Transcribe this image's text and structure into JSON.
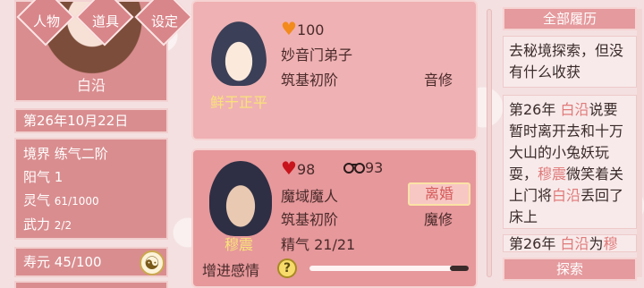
{
  "player": {
    "name": "白沿",
    "date": "第26年10月22日",
    "realm_label": "境界",
    "realm_value": "练气二阶",
    "yang_label": "阳气",
    "yang_value": "1",
    "spirit_label": "灵气",
    "spirit_value": "61/1000",
    "force_label": "武力",
    "force_value": "2/2",
    "life_label": "寿元",
    "life_value": "45/100"
  },
  "menu": {
    "character": "人物",
    "items": "道具",
    "settings": "设定"
  },
  "npcs": [
    {
      "name": "鲜于正平",
      "affection": "100",
      "faction": "妙音门弟子",
      "stage": "筑基初阶",
      "path": "音修"
    },
    {
      "name": "穆震",
      "affection": "98",
      "bond": "93",
      "faction": "魔域魔人",
      "stage": "筑基初阶",
      "path": "魔修",
      "essence_label": "精气",
      "essence_value": "21/21",
      "divorce_label": "离婚",
      "improve_label": "增进感情",
      "help_glyph": "?",
      "improve_progress": 0.12
    }
  ],
  "history": {
    "all_button": "全部履历",
    "explore_button": "探索",
    "entries": [
      {
        "text": "去秘境探索，但没有什么收获"
      },
      {
        "parts": [
          "第26年 ",
          "白沿",
          "说要暂时离开去和十万大山的小兔妖玩耍，",
          "穆震",
          "微笑着关上门将",
          "白沿",
          "丢回了床上"
        ]
      },
      {
        "parts": [
          "第26年 ",
          "白沿",
          "为",
          "穆"
        ]
      }
    ]
  },
  "icons": {
    "heart": "♥",
    "handcuffs": "handcuffs-icon",
    "yinyang": "☯"
  },
  "colors": {
    "card": "#e59a9d",
    "name_gold": "#f9e27a",
    "highlight": "#e07a7a",
    "heart_orange": "#f28a1c",
    "heart_red": "#c8141c"
  }
}
